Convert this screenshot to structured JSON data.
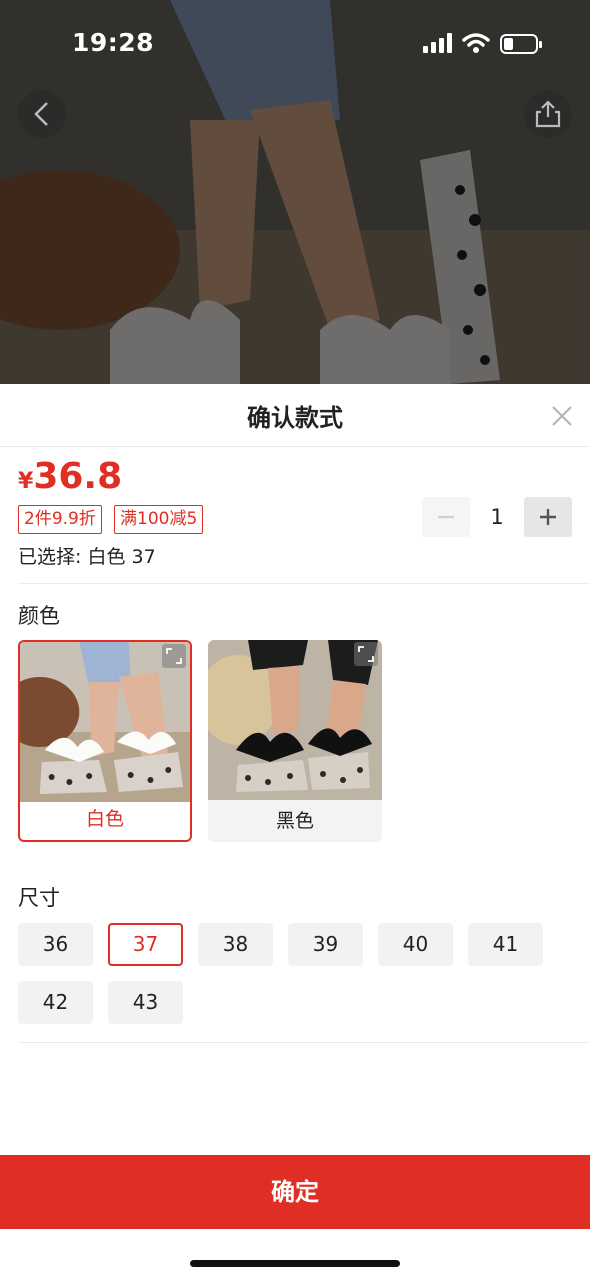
{
  "status_bar": {
    "time": "19:28"
  },
  "sheet": {
    "title": "确认款式"
  },
  "price": {
    "currency": "¥",
    "amount": "36.8"
  },
  "tags": [
    "2件9.9折",
    "满100减5"
  ],
  "selection": {
    "text": "已选择: 白色 37"
  },
  "quantity": {
    "value": "1"
  },
  "color_section": {
    "label": "颜色",
    "options": [
      {
        "label": "白色",
        "selected": true
      },
      {
        "label": "黑色",
        "selected": false
      }
    ]
  },
  "size_section": {
    "label": "尺寸",
    "options": [
      {
        "label": "36",
        "selected": false
      },
      {
        "label": "37",
        "selected": true
      },
      {
        "label": "38",
        "selected": false
      },
      {
        "label": "39",
        "selected": false
      },
      {
        "label": "40",
        "selected": false
      },
      {
        "label": "41",
        "selected": false
      },
      {
        "label": "42",
        "selected": false
      },
      {
        "label": "43",
        "selected": false
      }
    ]
  },
  "confirm_label": "确定",
  "colors": {
    "accent": "#e02e24",
    "chip_bg": "#f2f2f2"
  },
  "icons": [
    "signal-icon",
    "wifi-icon",
    "battery-icon",
    "back-arrow-icon",
    "share-icon",
    "close-icon",
    "minus-icon",
    "plus-icon",
    "expand-icon"
  ]
}
